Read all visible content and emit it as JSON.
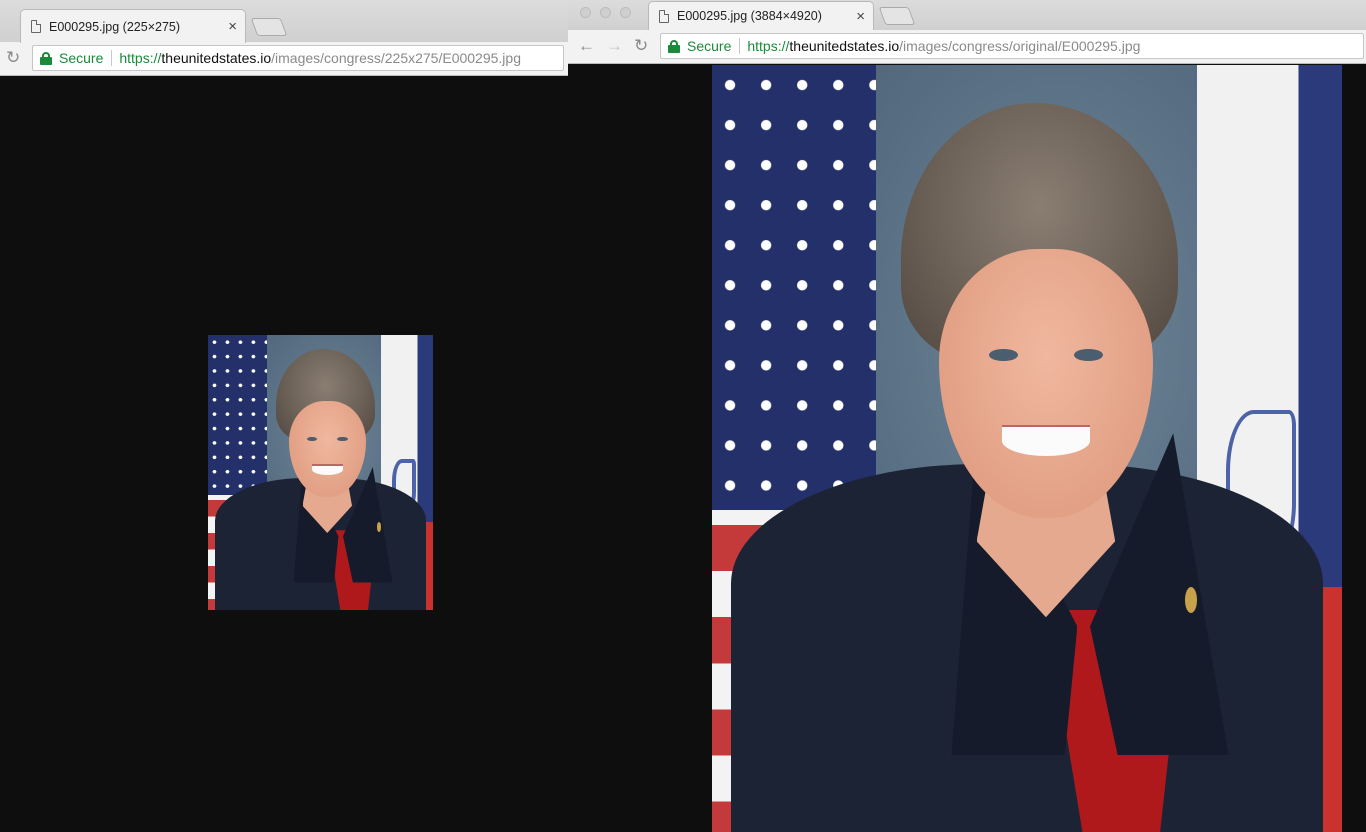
{
  "left_window": {
    "tab_title": "E000295.jpg (225×275)",
    "tab_close": "×",
    "nav": {
      "reload_icon": "reload-icon"
    },
    "address": {
      "secure_label": "Secure",
      "url_scheme": "https://",
      "url_host": "theunitedstates.io",
      "url_path": "/images/congress/225x275/E000295.jpg"
    },
    "image_alt": "E000295.jpg"
  },
  "right_window": {
    "tab_title": "E000295.jpg (3884×4920)",
    "tab_close": "×",
    "nav": {
      "back_icon": "arrow-left-icon",
      "forward_icon": "arrow-right-icon",
      "reload_icon": "reload-icon"
    },
    "address": {
      "secure_label": "Secure",
      "url_scheme": "https://",
      "url_host": "theunitedstates.io",
      "url_path": "/images/congress/original/E000295.jpg"
    },
    "image_alt": "E000295.jpg"
  },
  "colors": {
    "secure_green": "#1a8a3a",
    "page_background": "#0e0e0f",
    "chrome_background": "#f2f2f2"
  }
}
